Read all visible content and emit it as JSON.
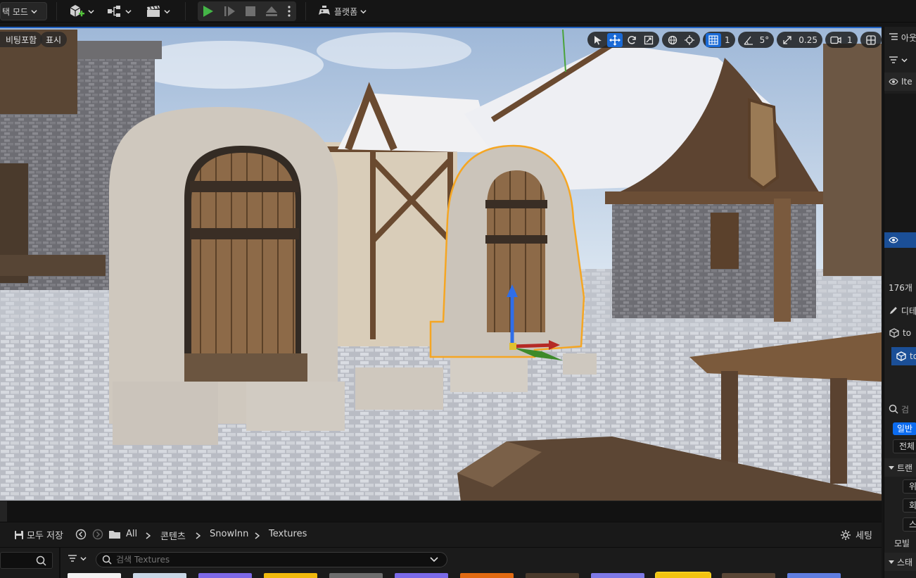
{
  "toolbar": {
    "mode_label": "택 모드",
    "platform_label": "플랫폼"
  },
  "viewport": {
    "left_button_1": "비팅포함",
    "left_button_2": "표시",
    "grid_value": "1",
    "angle_value": "5°",
    "scale_value": "0.25",
    "camera_value": "1"
  },
  "right_panel": {
    "header_label": "아웃",
    "filter_label": "Ite",
    "count_label": "176개",
    "details_label": "디테",
    "item_1": "to",
    "item_2": "to",
    "search_placeholder": "검",
    "general_tab": "일반",
    "all_tab": "전체",
    "transform_section": "트랜",
    "location_label": "위",
    "rotation_label": "회",
    "scale_label": "스",
    "mobility_label": "모빌",
    "static_section": "스태"
  },
  "content_browser": {
    "save_all": "모두 저장",
    "breadcrumb": [
      "All",
      "콘텐츠",
      "SnowInn",
      "Textures"
    ],
    "settings": "세팅",
    "search_placeholder": "검색 Textures",
    "thumbnail_colors": [
      "#f2f2f2",
      "#c9d7e6",
      "#7d69e6",
      "#f0b90c",
      "#6d6d6d",
      "#7a6ae8",
      "#e06a12",
      "#4a3a2c",
      "#7e79e6",
      "#f2c210",
      "#5a4636",
      "#5f7ee0"
    ]
  },
  "colors": {
    "accent": "#1a6ad6",
    "selection_outline": "#f5a623",
    "play_green": "#44b547"
  }
}
